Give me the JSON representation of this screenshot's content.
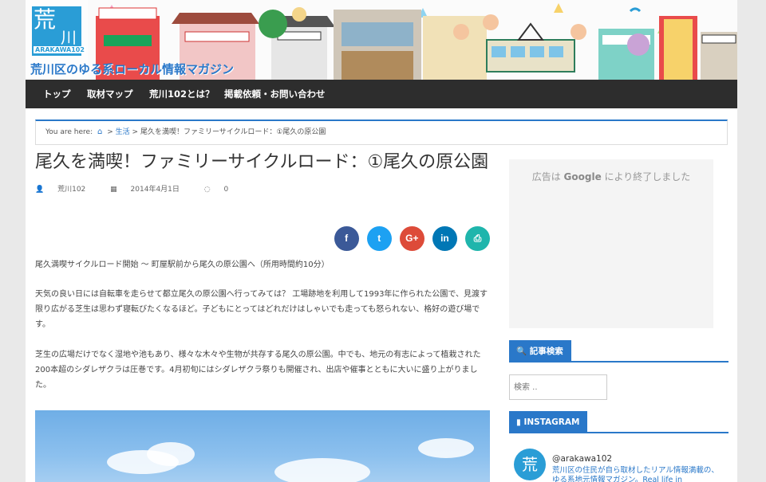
{
  "header": {
    "logo_kanji": "荒",
    "logo_kanji2": "川",
    "logo_sub": "ARAKAWA102",
    "site_description": "荒川区のゆる系ローカル情報マガジン"
  },
  "nav": {
    "items": [
      "トップ",
      "取材マップ",
      "荒川102とは？",
      "掲載依頼・お問い合わせ"
    ]
  },
  "breadcrumb": {
    "prefix": "You are here:",
    "category": "生活",
    "current": "尾久を満喫！ファミリーサイクルロード：①尾久の原公園",
    "separator": ">"
  },
  "post": {
    "title": "尾久を満喫！ファミリーサイクルロード：①尾久の原公園",
    "author": "荒川102",
    "date": "2014年4月1日",
    "comments": "0",
    "paragraphs": [
      "尾久満喫サイクルロード開始 〜 町屋駅前から尾久の原公園へ（所用時間約10分）",
      "天気の良い日には自転車を走らせて都立尾久の原公園へ行ってみては？ 工場跡地を利用して1993年に作られた公園で、見渡す限り広がる芝生は思わず寝転びたくなるほど。子どもにとってはどれだけはしゃいでも走っても怒られない、格好の遊び場です。",
      "芝生の広場だけでなく湿地や池もあり、様々な木々や生物が共存する尾久の原公園。中でも、地元の有志によって植栽された200本超のシダレザクラは圧巻です。4月初旬にはシダレザクラ祭りも開催され、出店や催事とともに大いに盛り上がりました。"
    ]
  },
  "share": {
    "buttons": [
      {
        "icon": "facebook-icon",
        "glyph": "f",
        "color": "#3b5998"
      },
      {
        "icon": "twitter-icon",
        "glyph": "t",
        "color": "#1da1f2"
      },
      {
        "icon": "google-plus-icon",
        "glyph": "G+",
        "color": "#dd4b39"
      },
      {
        "icon": "linkedin-icon",
        "glyph": "in",
        "color": "#0077b5"
      },
      {
        "icon": "print-icon",
        "glyph": "⎙",
        "color": "#1fb5ac"
      }
    ]
  },
  "sidebar": {
    "ad_text_before": "広告は",
    "ad_brand": "Google",
    "ad_text_after": "により終了しました",
    "search_title": "記事検索",
    "search_placeholder": "検索 ..",
    "instagram_title": "INSTAGRAM",
    "instagram_avatar": "荒",
    "instagram_user": "@arakawa102",
    "instagram_bio": "荒川区の住民が自ら取材したリアル情報満載の、ゆる系地元情報マガジン。Real life in"
  },
  "colors": {
    "accent": "#2a78c9",
    "nav_bg": "#2d2d2d"
  }
}
